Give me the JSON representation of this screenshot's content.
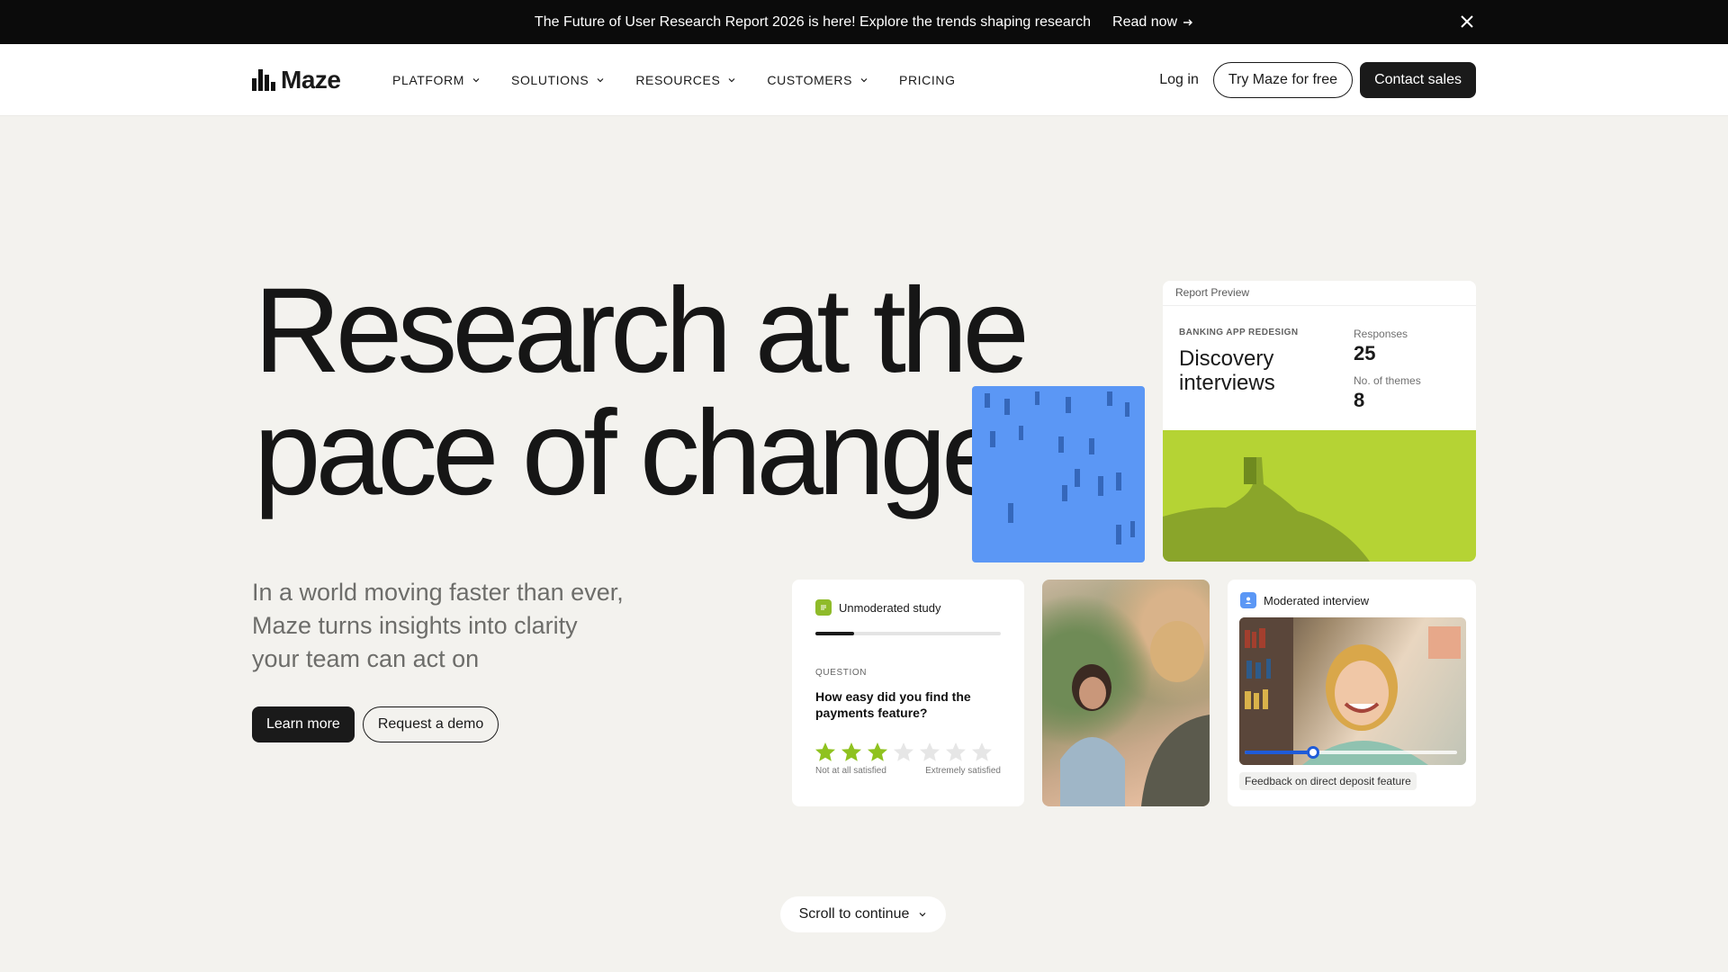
{
  "announcement": {
    "message": "The Future of User Research Report 2026 is here! Explore the trends shaping research",
    "link_label": "Read now"
  },
  "header": {
    "logo_text": "Maze",
    "nav": [
      {
        "label": "PLATFORM",
        "has_dropdown": true
      },
      {
        "label": "SOLUTIONS",
        "has_dropdown": true
      },
      {
        "label": "RESOURCES",
        "has_dropdown": true
      },
      {
        "label": "CUSTOMERS",
        "has_dropdown": true
      },
      {
        "label": "PRICING",
        "has_dropdown": false
      }
    ],
    "login_label": "Log in",
    "try_label": "Try Maze for free",
    "contact_label": "Contact sales"
  },
  "hero": {
    "title_line1": "Research at the",
    "title_line2": "pace of change",
    "subtitle_line1": "In a world moving faster than ever,",
    "subtitle_line2": "Maze turns insights into clarity",
    "subtitle_line3": "your team can act on",
    "primary_cta": "Learn more",
    "secondary_cta": "Request a demo"
  },
  "report_card": {
    "header": "Report Preview",
    "kicker": "BANKING APP REDESIGN",
    "title_line1": "Discovery",
    "title_line2": "interviews",
    "responses_label": "Responses",
    "responses_value": "25",
    "themes_label": "No. of themes",
    "themes_value": "8"
  },
  "unmoderated_card": {
    "label": "Unmoderated study",
    "progress": 0.21,
    "question_label": "QUESTION",
    "question_line1": "How easy did you find the",
    "question_line2": "payments feature?",
    "rating": 3,
    "rating_max": 7,
    "low_label": "Not at all satisfied",
    "high_label": "Extremely satisfied"
  },
  "moderated_card": {
    "label": "Moderated interview",
    "playback": 0.32,
    "caption": "Feedback on direct deposit feature"
  },
  "scroll": {
    "label": "Scroll to continue"
  },
  "colors": {
    "background": "#f3f2ee",
    "dark": "#1a1a1a",
    "accent_green": "#b5d334",
    "star_green": "#8fc21f",
    "accent_blue": "#5b97f5",
    "scrub_blue": "#1f5bd8"
  }
}
